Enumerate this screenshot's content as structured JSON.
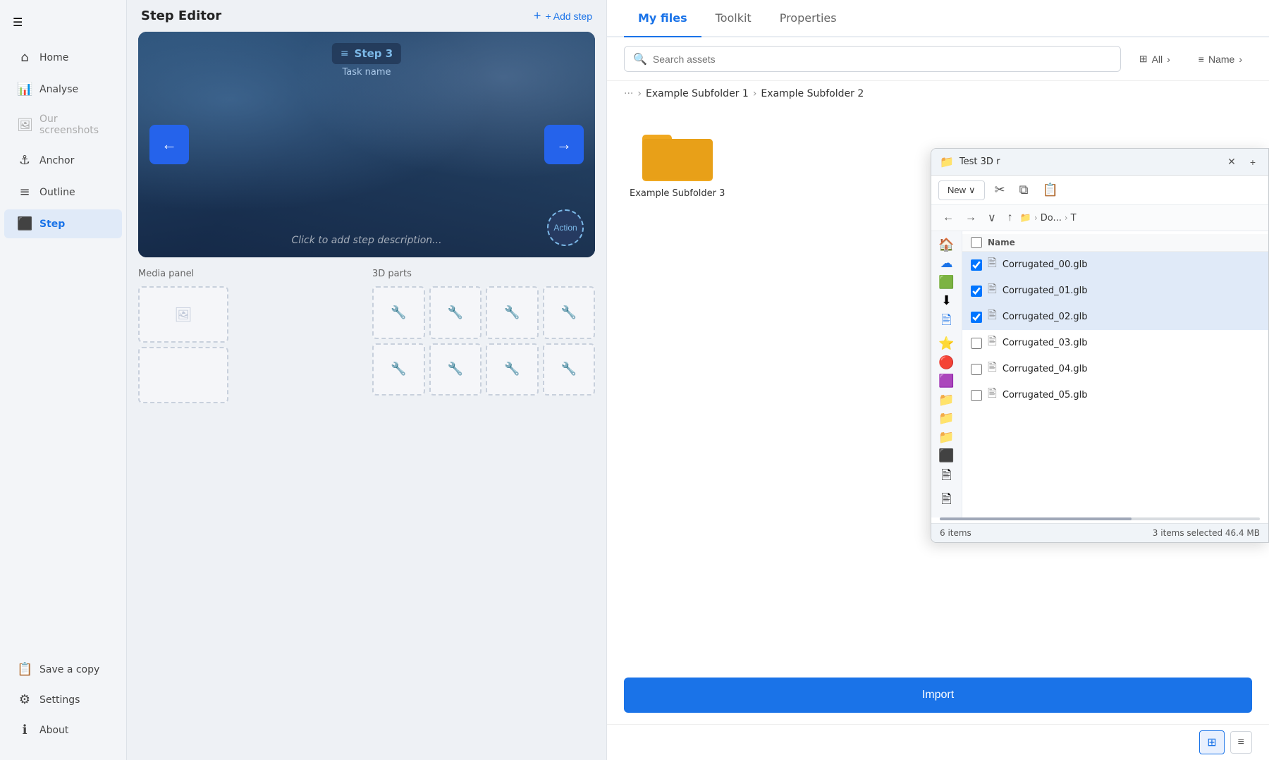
{
  "sidebar": {
    "menu_icon": "☰",
    "items": [
      {
        "id": "home",
        "label": "Home",
        "icon": "⌂",
        "active": false
      },
      {
        "id": "analyse",
        "label": "Analyse",
        "icon": "📊",
        "active": false
      },
      {
        "id": "our-screenshots",
        "label": "Our screenshots",
        "icon": "🖼",
        "active": false,
        "disabled": true
      },
      {
        "id": "anchor",
        "label": "Anchor",
        "icon": "⚓",
        "active": false
      },
      {
        "id": "outline",
        "label": "Outline",
        "icon": "☰",
        "active": false
      },
      {
        "id": "step",
        "label": "Step",
        "icon": "⬛",
        "active": true
      }
    ],
    "bottom_items": [
      {
        "id": "save-copy",
        "label": "Save a copy",
        "icon": "📋"
      },
      {
        "id": "settings",
        "label": "Settings",
        "icon": "⚙"
      },
      {
        "id": "about",
        "label": "About",
        "icon": "ℹ"
      }
    ]
  },
  "step_editor": {
    "title": "Step Editor",
    "add_step_label": "+ Add step",
    "step": {
      "name": "Step 3",
      "task_label": "Task name",
      "description_placeholder": "Click to add step description...",
      "action_label": "Action"
    },
    "media_panel": {
      "title": "Media panel"
    },
    "parts_panel": {
      "title": "3D parts"
    }
  },
  "files_panel": {
    "tabs": [
      {
        "id": "my-files",
        "label": "My files",
        "active": true
      },
      {
        "id": "toolkit",
        "label": "Toolkit",
        "active": false
      },
      {
        "id": "properties",
        "label": "Properties",
        "active": false
      }
    ],
    "search_placeholder": "Search assets",
    "filter_label": "All",
    "name_label": "Name",
    "breadcrumb": {
      "dots": "···",
      "items": [
        {
          "label": "Example Subfolder 1"
        },
        {
          "label": "Example Subfolder 2"
        }
      ]
    },
    "folder": {
      "name": "Example Subfolder 3"
    },
    "import_label": "Import"
  },
  "file_explorer": {
    "title": "Test 3D r",
    "toolbar": {
      "new_label": "New",
      "cut_icon": "✂",
      "copy_icon": "⧉",
      "paste_icon": "📋"
    },
    "nav": {
      "back_icon": "←",
      "forward_icon": "→",
      "down_icon": "∨",
      "up_icon": "↑",
      "folder_icon": "📁",
      "path": [
        "Do...",
        "T"
      ]
    },
    "columns": {
      "name_label": "Name"
    },
    "files": [
      {
        "name": "Corrugated_00.glb",
        "selected": true
      },
      {
        "name": "Corrugated_01.glb",
        "selected": true
      },
      {
        "name": "Corrugated_02.glb",
        "selected": true
      },
      {
        "name": "Corrugated_03.glb",
        "selected": false
      },
      {
        "name": "Corrugated_04.glb",
        "selected": false
      },
      {
        "name": "Corrugated_05.glb",
        "selected": false
      }
    ],
    "statusbar": {
      "items_count": "6 items",
      "selected_info": "3 items selected  46.4 MB"
    },
    "sidebar_icons": [
      "🏠",
      "☁",
      "🟩",
      "⬇",
      "🖹",
      "⭐",
      "🔴",
      "🟪",
      "📁",
      "📁",
      "📁",
      "⬛",
      "🖹",
      "🖹"
    ]
  }
}
